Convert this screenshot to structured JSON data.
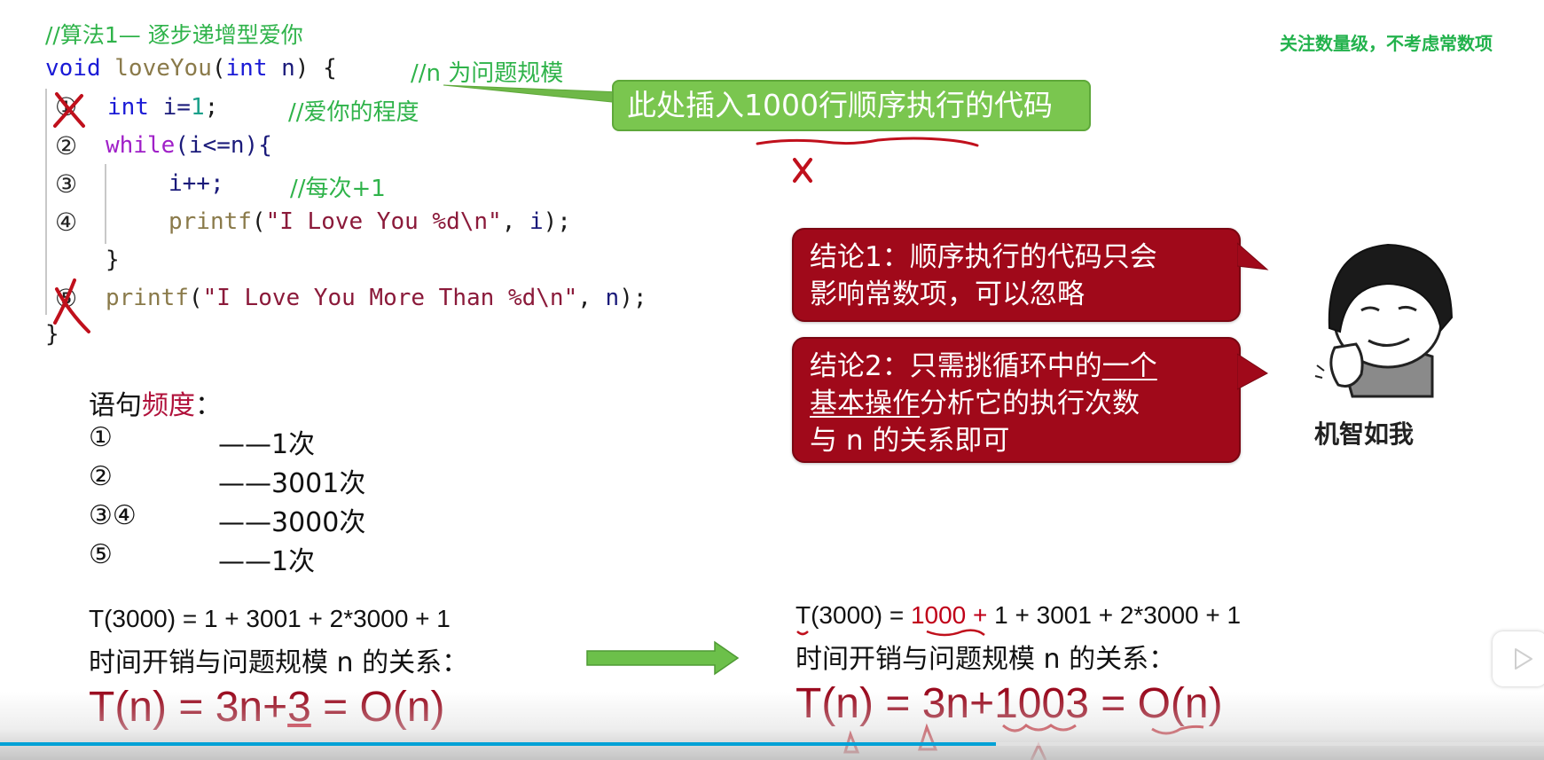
{
  "top_note": "关注数量级，不考虑常数项",
  "code": {
    "title_comment": "//算法1— 逐步递增型爱你",
    "signature": {
      "kw_void": "void",
      "fn_name": "loveYou",
      "paren_open": "(",
      "kw_int": "int",
      "param": "n",
      "rest": ") {",
      "comment": "//n 为问题规模"
    },
    "lines": [
      {
        "marker": "①",
        "crossed": true,
        "kw": "int",
        "text": "i=",
        "num": "1",
        "end": ";",
        "comment": "//爱你的程度"
      },
      {
        "marker": "②",
        "crossed": false,
        "kw": "while",
        "text": "(i<=n){"
      },
      {
        "marker": "③",
        "crossed": false,
        "text": "i++;",
        "comment": "//每次+1"
      },
      {
        "marker": "④",
        "crossed": false,
        "fn": "printf",
        "open": "(",
        "str": "\"I Love You %d\\n\"",
        "args": ", ",
        "var": "i",
        "end": ");"
      },
      {
        "text": "}"
      },
      {
        "marker": "⑤",
        "crossed": true,
        "fn": "printf",
        "open": "(",
        "str": "\"I Love You More Than %d\\n\"",
        "args": ", ",
        "var": "n",
        "end": ");"
      }
    ],
    "closing_brace": "}"
  },
  "green_callout": "此处插入1000行顺序执行的代码",
  "annotation_x": "X",
  "conclusions": [
    {
      "label": "结论1：",
      "text_line1": "顺序执行的代码只会",
      "text_line2": "影响常数项，可以忽略"
    },
    {
      "label": "结论2：",
      "text_a": "只需挑循环中的",
      "text_u1": "一个",
      "text_u2": "基本操作",
      "text_b": "分析它的执行次数",
      "text_line3": "与 n 的关系即可"
    }
  ],
  "meme_caption": "机智如我",
  "frequency": {
    "title_a": "语句",
    "title_hl": "频度",
    "title_colon": "：",
    "rows": [
      {
        "marker": "①",
        "count": "——1次"
      },
      {
        "marker": "②",
        "count": "——3001次"
      },
      {
        "marker": "③④",
        "count": "——3000次"
      },
      {
        "marker": "⑤",
        "count": "——1次"
      }
    ]
  },
  "left_eq": {
    "t3000": "T(3000) = 1 + 3001 + 2*3000 + 1",
    "relation": "时间开销与问题规模 n 的关系：",
    "big_a": "T(n) = 3n+",
    "big_u": "3",
    "big_b": " = O(n)"
  },
  "right_eq": {
    "t3000_a": "T(3000) = ",
    "t3000_red": "1000 +",
    "t3000_b": " 1 + 3001 + 2*3000 + 1",
    "relation": "时间开销与问题规模 n 的关系：",
    "big": "T(n) = 3n+1003 = O(n)"
  },
  "video": {
    "progress_percent": 64.5,
    "colors": {
      "progress": "#00a1d6"
    }
  },
  "colors": {
    "accent_green": "#7ac64f",
    "accent_red": "#a0091a",
    "note_green": "#22b24c"
  }
}
